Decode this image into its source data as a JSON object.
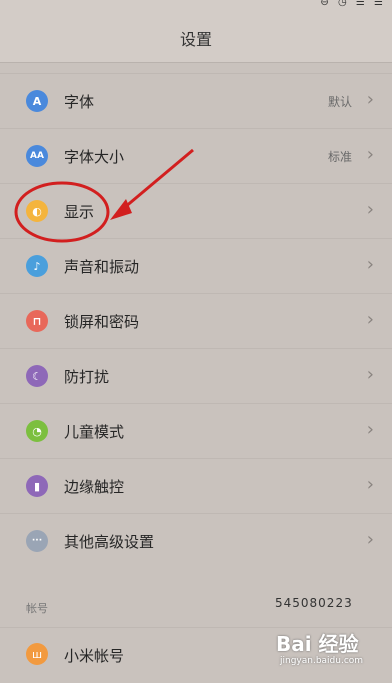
{
  "header": {
    "title": "设置"
  },
  "status_bar": {
    "icons": "⊖ ◷ ☰ ☰"
  },
  "settings": [
    {
      "label": "字体",
      "value": "默认",
      "icon_letter": "A",
      "icon_color": "#4a89dc"
    },
    {
      "label": "字体大小",
      "value": "标准",
      "icon_letter": "AA",
      "icon_color": "#4a89dc"
    },
    {
      "label": "显示",
      "value": "",
      "icon_letter": "◐",
      "icon_color": "#f4b43d"
    },
    {
      "label": "声音和振动",
      "value": "",
      "icon_letter": "♪",
      "icon_color": "#4a9fdc"
    },
    {
      "label": "锁屏和密码",
      "value": "",
      "icon_letter": "⊓",
      "icon_color": "#e8685a"
    },
    {
      "label": "防打扰",
      "value": "",
      "icon_letter": "☾",
      "icon_color": "#8e68b8"
    },
    {
      "label": "儿童模式",
      "value": "",
      "icon_letter": "◔",
      "icon_color": "#7cbf3f"
    },
    {
      "label": "边缘触控",
      "value": "",
      "icon_letter": "▮",
      "icon_color": "#8e68b8"
    },
    {
      "label": "其他高级设置",
      "value": "",
      "icon_letter": "···",
      "icon_color": "#9aa5b5"
    }
  ],
  "account_section": {
    "label": "帐号",
    "row_label": "小米帐号",
    "icon_letter": "ш"
  },
  "overlay": {
    "number": "545080223",
    "watermark_main": "Bai 经验",
    "watermark_sub": "jingyan.baidu.com"
  },
  "chevron": "›"
}
